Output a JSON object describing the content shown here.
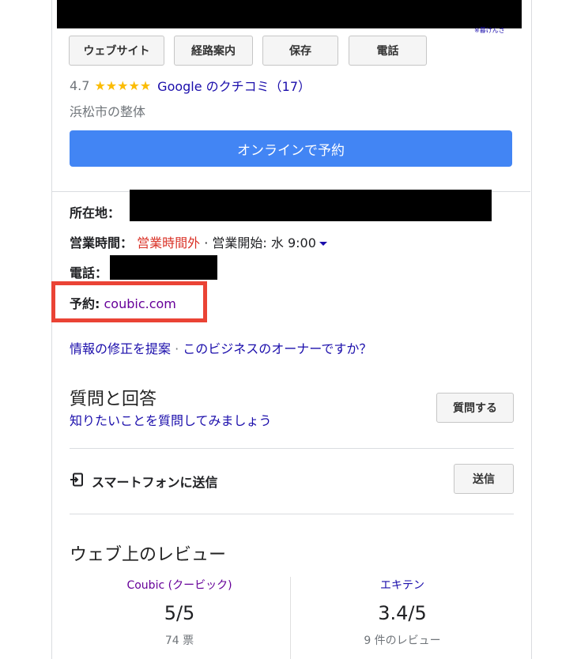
{
  "top_small_text": "※暮けんさ",
  "actions": [
    "ウェブサイト",
    "経路案内",
    "保存",
    "電話"
  ],
  "rating": {
    "score": "4.7",
    "stars": "★★★★★",
    "reviews_link": "Google のクチコミ（17）",
    "value": 4.7
  },
  "category": "浜松市の整体",
  "book_button": "オンラインで予約",
  "info": {
    "address_label": "所在地：",
    "hours_label": "営業時間：",
    "hours_status": "営業時間外",
    "hours_sep": " · ",
    "hours_next": "営業開始: 水 9:00",
    "phone_label": "電話：",
    "booking_label": "予約:",
    "booking_link": "coubic.com"
  },
  "suggest": {
    "edit": "情報の修正を提案",
    "sep": " · ",
    "owner": "このビジネスのオーナーですか？"
  },
  "qa": {
    "title": "質問と回答",
    "subtitle": "知りたいことを質問してみましょう",
    "ask_button": "質問する"
  },
  "send": {
    "label": "スマートフォンに送信",
    "button": "送信"
  },
  "reviews": {
    "title": "ウェブ上のレビュー",
    "items": [
      {
        "source": "Coubic (クービック)",
        "score": "5/5",
        "count": "74 票"
      },
      {
        "source": "エキテン",
        "score": "3.4/5",
        "count": "9 件のレビュー"
      }
    ]
  },
  "colors": {
    "accent_blue": "#4285f4",
    "link": "#1a0dab",
    "status_red": "#d93025",
    "highlight_red": "#ea4335",
    "star": "#fbbc04"
  }
}
